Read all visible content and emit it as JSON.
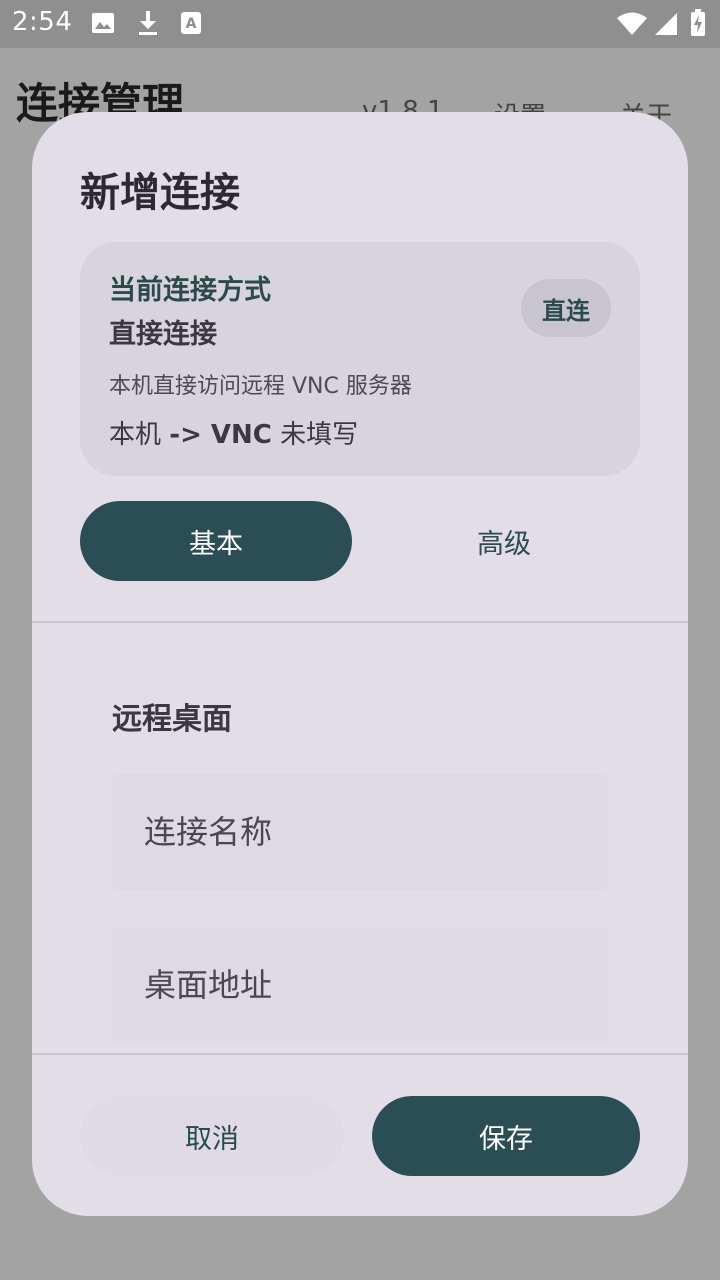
{
  "status_bar": {
    "time": "2:54",
    "notification_icons": [
      "image-icon",
      "download-icon",
      "font-icon"
    ],
    "system_icons": [
      "wifi-icon",
      "signal-icon",
      "battery-charging-icon"
    ]
  },
  "app_bar": {
    "title": "连接管理",
    "actions": [
      "v1.8.1",
      "设置",
      "关于"
    ]
  },
  "dialog": {
    "title": "新增连接",
    "connection_mode": {
      "heading": "当前连接方式",
      "name": "直接连接",
      "description": "本机直接访问远程 VNC 服务器",
      "route_prefix": "本机",
      "route_arrow": "-> VNC",
      "route_status": "未填写",
      "chip_label": "直连"
    },
    "tabs": [
      {
        "label": "基本",
        "selected": true
      },
      {
        "label": "高级",
        "selected": false
      }
    ],
    "section_label": "远程桌面",
    "fields": {
      "name_placeholder": "连接名称",
      "name_value": "",
      "address_placeholder": "桌面地址",
      "address_value": ""
    },
    "buttons": {
      "cancel": "取消",
      "save": "保存"
    }
  },
  "colors": {
    "accent": "#2a4e53",
    "dialog_bg": "#e2dde7",
    "card_bg": "#d8d4dc",
    "scrim": "#a3a3a3"
  }
}
